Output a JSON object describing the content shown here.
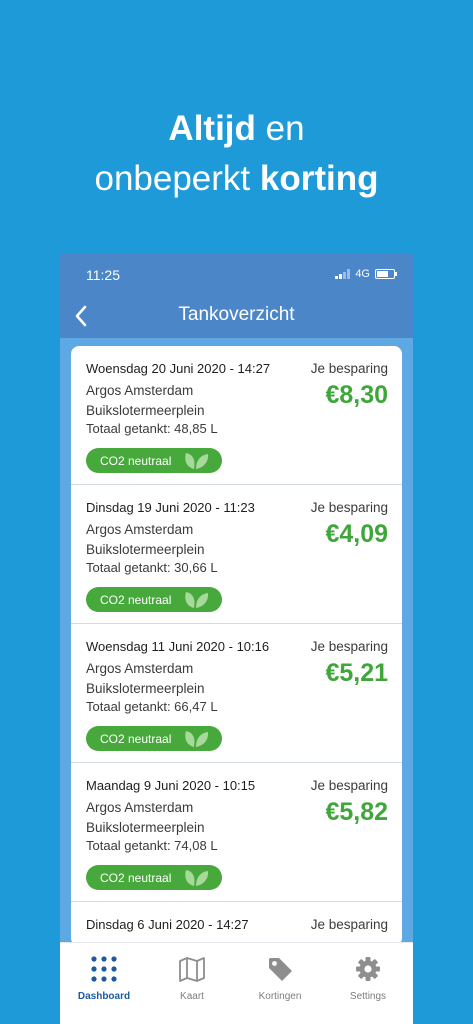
{
  "headline": {
    "bold1": "Altijd",
    "normal1": " en",
    "normal2": "onbeperkt ",
    "bold2": "korting"
  },
  "status": {
    "time": "11:25",
    "network": "4G"
  },
  "nav": {
    "title": "Tankoverzicht"
  },
  "cards": [
    {
      "date": "Woensdag 20 Juni 2020 -  14:27",
      "station_line1": "Argos Amsterdam",
      "station_line2": "Buikslotermeerplein",
      "total": "Totaal getankt: 48,85 L",
      "save_label": "Je besparing",
      "amount": "€8,30",
      "badge": "CO2 neutraal"
    },
    {
      "date": "Dinsdag   19  Juni 2020 - 11:23",
      "station_line1": "Argos Amsterdam",
      "station_line2": "Buikslotermeerplein",
      "total": "Totaal getankt: 30,66 L",
      "save_label": "Je besparing",
      "amount": "€4,09",
      "badge": "CO2 neutraal"
    },
    {
      "date": "Woensdag 11 Juni 2020 - 10:16",
      "station_line1": "Argos Amsterdam",
      "station_line2": "Buikslotermeerplein",
      "total": "Totaal getankt: 66,47 L",
      "save_label": "Je besparing",
      "amount": "€5,21",
      "badge": "CO2 neutraal"
    },
    {
      "date": "Maandag   9  Juni 2020 - 10:15",
      "station_line1": "Argos Amsterdam",
      "station_line2": "Buikslotermeerplein",
      "total": "Totaal getankt: 74,08 L",
      "save_label": "Je besparing",
      "amount": "€5,82",
      "badge": "CO2 neutraal"
    },
    {
      "date": "Dinsdag 6 Juni 2020 - 14:27",
      "station_line1": "",
      "station_line2": "",
      "total": "",
      "save_label": "Je besparing",
      "amount": "",
      "badge": ""
    }
  ],
  "tabs": [
    {
      "label": "Dashboard",
      "icon": "dots-grid-icon"
    },
    {
      "label": "Kaart",
      "icon": "map-icon"
    },
    {
      "label": "Kortingen",
      "icon": "tag-icon"
    },
    {
      "label": "Settings",
      "icon": "gear-icon"
    }
  ],
  "colors": {
    "background": "#1f9ad9",
    "header": "#4b86c8",
    "green": "#47a83c",
    "active_tab": "#1d5aa0"
  }
}
